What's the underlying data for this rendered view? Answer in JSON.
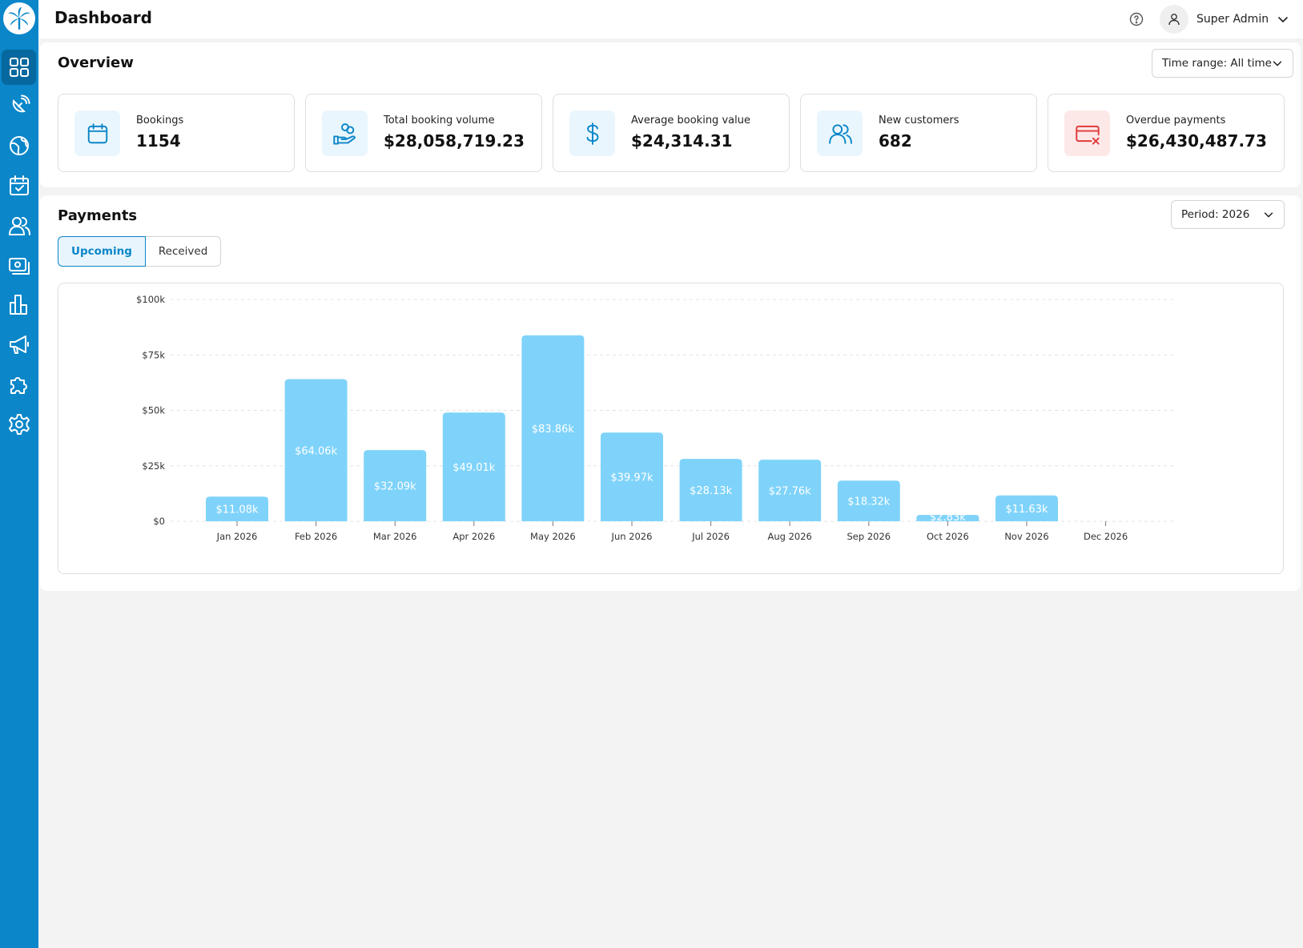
{
  "header": {
    "title": "Dashboard",
    "user_name": "Super Admin"
  },
  "sidebar": {
    "items": [
      {
        "icon": "grid-icon",
        "active": true
      },
      {
        "icon": "satellite-dish-icon",
        "active": false
      },
      {
        "icon": "globe-icon",
        "active": false
      },
      {
        "icon": "calendar-check-icon",
        "active": false
      },
      {
        "icon": "users-icon",
        "active": false
      },
      {
        "icon": "cash-icon",
        "active": false
      },
      {
        "icon": "bar-chart-icon",
        "active": false
      },
      {
        "icon": "megaphone-icon",
        "active": false
      },
      {
        "icon": "puzzle-icon",
        "active": false
      },
      {
        "icon": "gear-icon",
        "active": false
      }
    ]
  },
  "overview": {
    "title": "Overview",
    "time_range": "Time range: All time",
    "stats": [
      {
        "label": "Bookings",
        "value": "1154",
        "icon": "calendar-icon"
      },
      {
        "label": "Total booking volume",
        "value": "$28,058,719.23",
        "icon": "hand-coins-icon"
      },
      {
        "label": "Average booking value",
        "value": "$24,314.31",
        "icon": "dollar-icon"
      },
      {
        "label": "New customers",
        "value": "682",
        "icon": "users-icon"
      },
      {
        "label": "Overdue payments",
        "value": "$26,430,487.73",
        "icon": "card-error-icon"
      }
    ]
  },
  "payments": {
    "title": "Payments",
    "period": "Period: 2026",
    "tabs": [
      "Upcoming",
      "Received"
    ],
    "active_tab": "Upcoming"
  },
  "colors": {
    "brand": "#0a86c9",
    "bar": "#7fd3fa",
    "overdue_bg": "#fde8e8",
    "overdue_icon": "#e03a3a",
    "icon_bg": "#eaf6fd"
  },
  "chart_data": {
    "type": "bar",
    "categories": [
      "Jan 2026",
      "Feb 2026",
      "Mar 2026",
      "Apr 2026",
      "May 2026",
      "Jun 2026",
      "Jul 2026",
      "Aug 2026",
      "Sep 2026",
      "Oct 2026",
      "Nov 2026",
      "Dec 2026"
    ],
    "values": [
      11080,
      64060,
      32090,
      49010,
      83860,
      39970,
      28130,
      27760,
      18320,
      2830,
      11630,
      0
    ],
    "data_labels": [
      "$11.08k",
      "$64.06k",
      "$32.09k",
      "$49.01k",
      "$83.86k",
      "$39.97k",
      "$28.13k",
      "$27.76k",
      "$18.32k",
      "$2.83k",
      "$11.63k",
      ""
    ],
    "yticks": [
      0,
      25000,
      50000,
      75000,
      100000
    ],
    "ytick_labels": [
      "$0",
      "$25k",
      "$50k",
      "$75k",
      "$100k"
    ],
    "ylim": [
      0,
      100000
    ],
    "grid": true,
    "title": "",
    "xlabel": "",
    "ylabel": ""
  }
}
